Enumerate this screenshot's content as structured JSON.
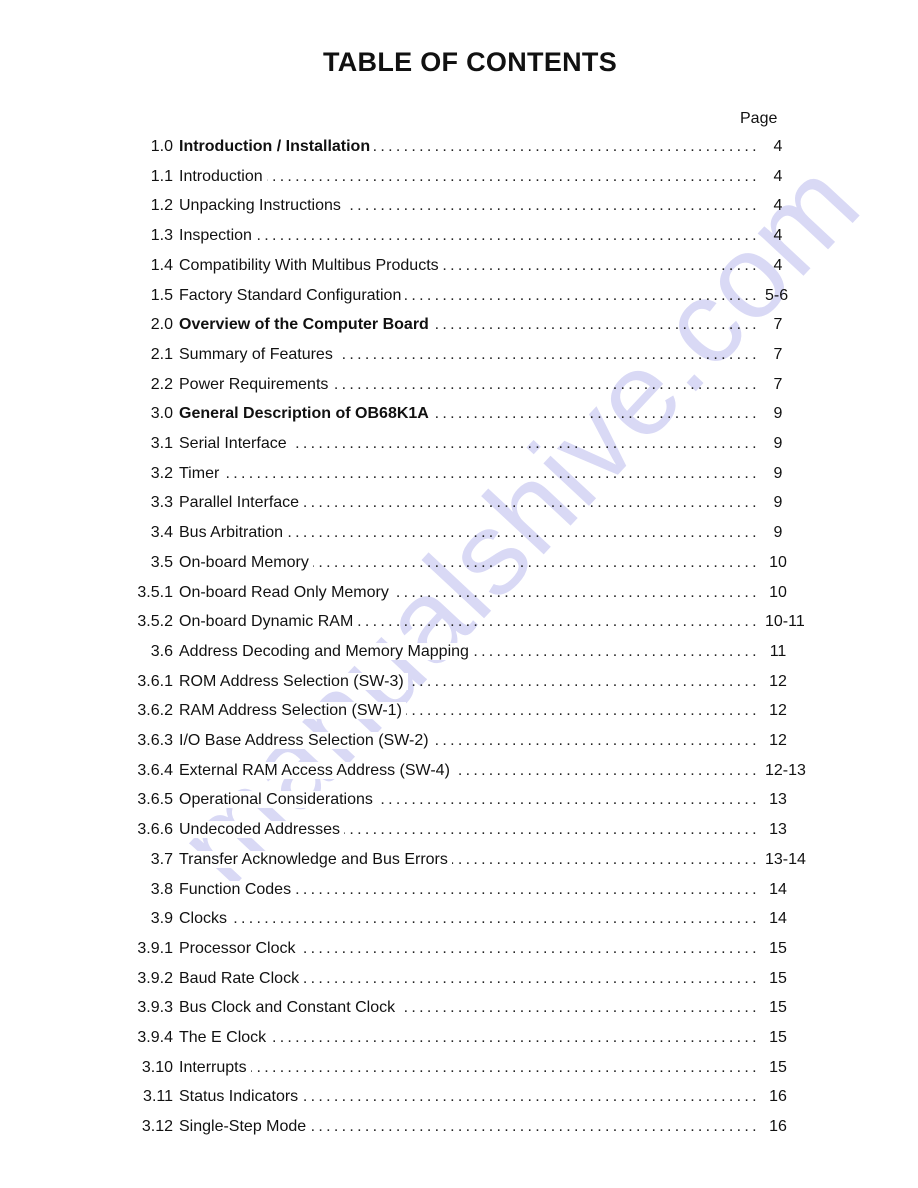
{
  "title": "TABLE OF CONTENTS",
  "page_column_header": "Page",
  "watermark": "manualshive.com",
  "entries": [
    {
      "num": "1.0",
      "label": "Introduction / Installation",
      "page": "4",
      "bold": true
    },
    {
      "num": "1.1",
      "label": "Introduction",
      "page": "4",
      "bold": false
    },
    {
      "num": "1.2",
      "label": "Unpacking Instructions",
      "page": "4",
      "bold": false
    },
    {
      "num": "1.3",
      "label": "Inspection",
      "page": "4",
      "bold": false
    },
    {
      "num": "1.4",
      "label": "Compatibility With Multibus Products",
      "page": "4",
      "bold": false
    },
    {
      "num": "1.5",
      "label": "Factory Standard Configuration",
      "page": "5-6",
      "bold": false
    },
    {
      "num": "2.0",
      "label": "Overview of the Computer Board",
      "page": "7",
      "bold": true
    },
    {
      "num": "2.1",
      "label": "Summary of Features",
      "page": "7",
      "bold": false
    },
    {
      "num": "2.2",
      "label": "Power Requirements",
      "page": "7",
      "bold": false
    },
    {
      "num": "3.0",
      "label": "General Description of OB68K1A",
      "page": "9",
      "bold": true
    },
    {
      "num": "3.1",
      "label": "Serial Interface",
      "page": "9",
      "bold": false
    },
    {
      "num": "3.2",
      "label": "Timer",
      "page": "9",
      "bold": false
    },
    {
      "num": "3.3",
      "label": "Parallel Interface",
      "page": "9",
      "bold": false
    },
    {
      "num": "3.4",
      "label": "Bus Arbitration",
      "page": "9",
      "bold": false
    },
    {
      "num": "3.5",
      "label": "On-board Memory",
      "page": "10",
      "bold": false
    },
    {
      "num": "3.5.1",
      "label": "On-board Read Only Memory",
      "page": "10",
      "bold": false
    },
    {
      "num": "3.5.2",
      "label": "On-board Dynamic RAM",
      "page": "10-11",
      "bold": false
    },
    {
      "num": "3.6",
      "label": "Address Decoding and Memory Mapping",
      "page": "11",
      "bold": false
    },
    {
      "num": "3.6.1",
      "label": "ROM Address Selection (SW-3)",
      "page": "12",
      "bold": false
    },
    {
      "num": "3.6.2",
      "label": "RAM Address Selection (SW-1)",
      "page": "12",
      "bold": false
    },
    {
      "num": "3.6.3",
      "label": "I/O Base Address Selection (SW-2)",
      "page": "12",
      "bold": false
    },
    {
      "num": "3.6.4",
      "label": "External RAM Access Address (SW-4)",
      "page": "12-13",
      "bold": false
    },
    {
      "num": "3.6.5",
      "label": "Operational Considerations",
      "page": "13",
      "bold": false
    },
    {
      "num": "3.6.6",
      "label": "Undecoded Addresses",
      "page": "13",
      "bold": false
    },
    {
      "num": "3.7",
      "label": "Transfer Acknowledge and Bus Errors",
      "page": "13-14",
      "bold": false
    },
    {
      "num": "3.8",
      "label": "Function Codes",
      "page": "14",
      "bold": false
    },
    {
      "num": "3.9",
      "label": "Clocks",
      "page": "14",
      "bold": false
    },
    {
      "num": "3.9.1",
      "label": "Processor Clock",
      "page": "15",
      "bold": false
    },
    {
      "num": "3.9.2",
      "label": "Baud Rate Clock",
      "page": "15",
      "bold": false
    },
    {
      "num": "3.9.3",
      "label": "Bus Clock and Constant Clock",
      "page": "15",
      "bold": false
    },
    {
      "num": "3.9.4",
      "label": "The E Clock",
      "page": "15",
      "bold": false
    },
    {
      "num": "3.10",
      "label": "Interrupts",
      "page": "15",
      "bold": false
    },
    {
      "num": "3.11",
      "label": "Status Indicators",
      "page": "16",
      "bold": false
    },
    {
      "num": "3.12",
      "label": "Single-Step Mode",
      "page": "16",
      "bold": false
    }
  ]
}
